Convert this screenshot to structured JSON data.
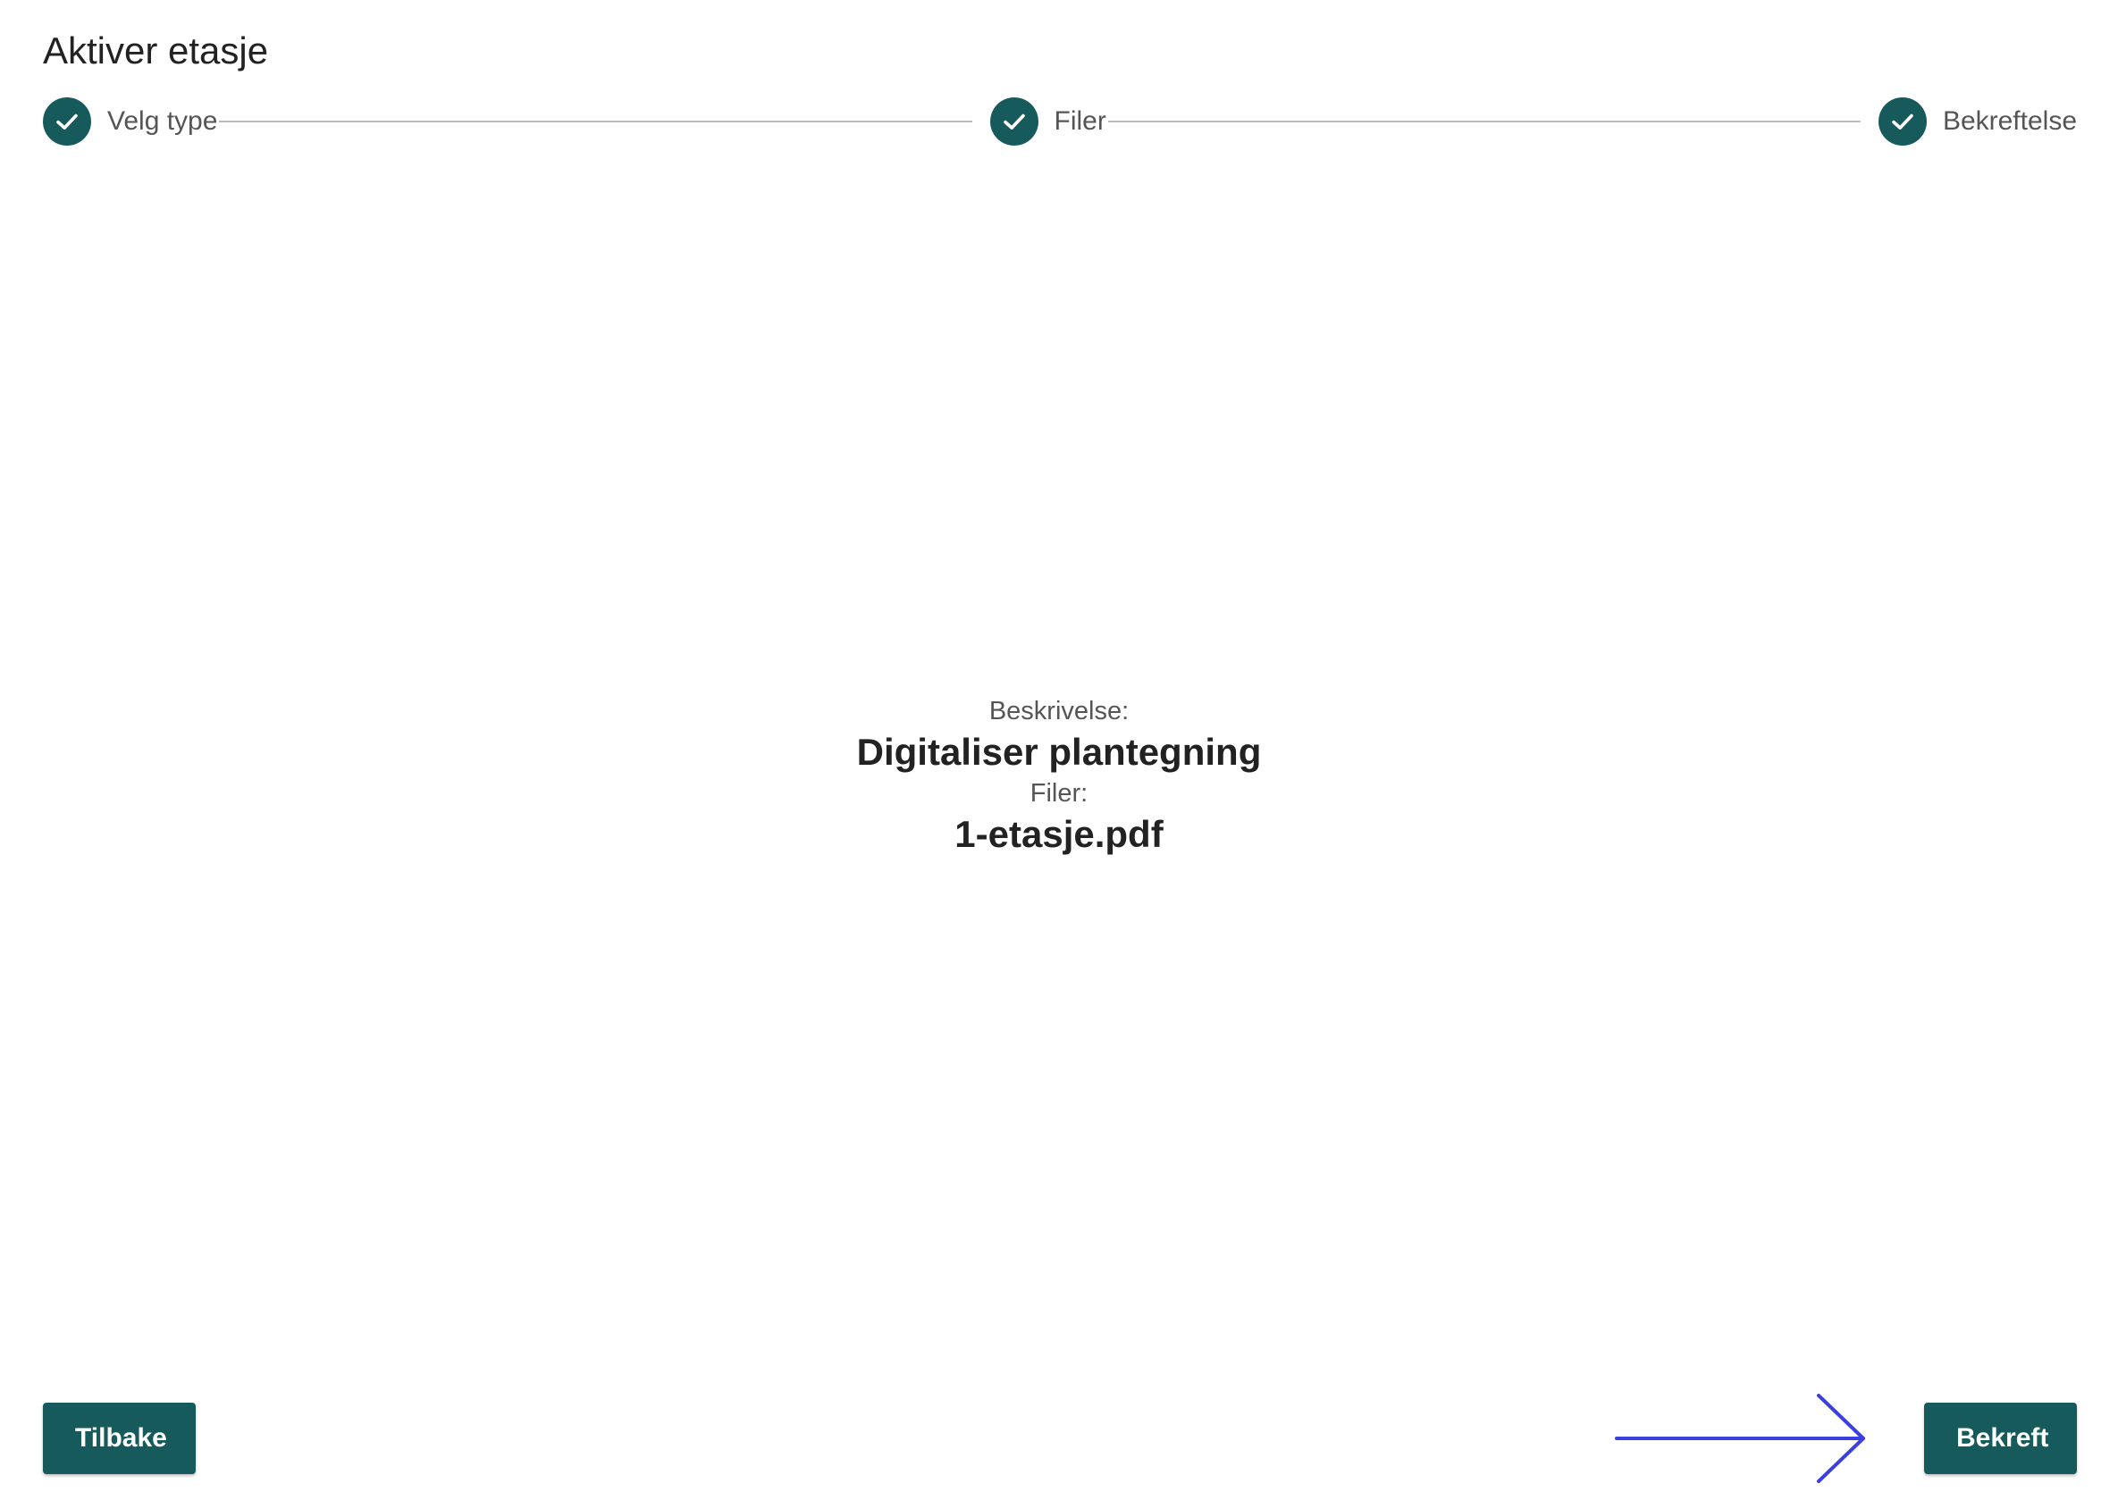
{
  "header": {
    "title": "Aktiver etasje"
  },
  "stepper": {
    "steps": [
      {
        "label": "Velg type",
        "icon": "check-icon",
        "status": "completed"
      },
      {
        "label": "Filer",
        "icon": "check-icon",
        "status": "completed"
      },
      {
        "label": "Bekreftelse",
        "icon": "check-icon",
        "status": "completed"
      }
    ]
  },
  "summary": {
    "description_label": "Beskrivelse:",
    "description_value": "Digitaliser plantegning",
    "files_label": "Filer:",
    "files_value": "1-etasje.pdf"
  },
  "actions": {
    "back_label": "Tilbake",
    "confirm_label": "Bekreft"
  },
  "annotation": {
    "icon": "arrow-right-icon",
    "color": "#3b3fe0"
  },
  "colors": {
    "primary": "#165a5c",
    "text": "#222222",
    "muted_text": "#555555",
    "connector": "#bdbdbd"
  }
}
